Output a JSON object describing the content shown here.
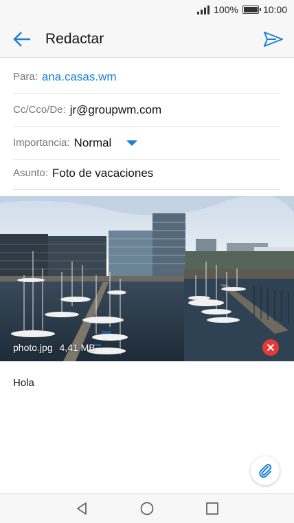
{
  "status_bar": {
    "battery_percent": "100%",
    "time": "10:00"
  },
  "app_bar": {
    "title": "Redactar",
    "back_icon": "arrow-left-icon",
    "send_icon": "send-icon"
  },
  "form": {
    "to": {
      "label": "Para:",
      "value": "ana.casas.wm"
    },
    "cc": {
      "label": "Cc/Cco/De:",
      "value": "jr@groupwm.com"
    },
    "importance": {
      "label": "Importancia:",
      "value": "Normal"
    },
    "subject": {
      "label": "Asunto:",
      "value": "Foto de vacaciones"
    }
  },
  "attachment": {
    "filename": "photo.jpg",
    "size": "4,41 MB"
  },
  "message_body": "Hola",
  "colors": {
    "accent": "#1a7fd4",
    "remove": "#e53935"
  }
}
